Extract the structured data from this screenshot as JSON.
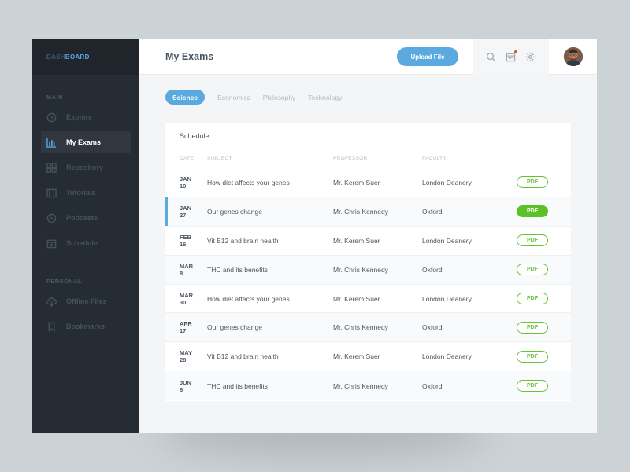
{
  "brand": {
    "part1": "DASH",
    "part2": "BOARD"
  },
  "sidebar": {
    "main_label": "MAIN",
    "main_items": [
      {
        "label": "Explore",
        "icon": "compass-icon"
      },
      {
        "label": "My Exams",
        "icon": "chart-icon",
        "active": true
      },
      {
        "label": "Repository",
        "icon": "grid-icon"
      },
      {
        "label": "Tutorials",
        "icon": "film-icon"
      },
      {
        "label": "Podcasts",
        "icon": "play-icon"
      },
      {
        "label": "Schedule",
        "icon": "calendar-icon"
      }
    ],
    "personal_label": "PERSONAL",
    "personal_items": [
      {
        "label": "Offline Files",
        "icon": "cloud-download-icon"
      },
      {
        "label": "Bookmarks",
        "icon": "bookmark-icon"
      }
    ]
  },
  "header": {
    "title": "My Exams",
    "upload_label": "Upload File"
  },
  "tabs": [
    "Science",
    "Economics",
    "Philosophy",
    "Technology"
  ],
  "schedule": {
    "title": "Schedule",
    "columns": [
      "DATE",
      "SUBJECT",
      "PROFESSOR",
      "FACULTY"
    ],
    "rows": [
      {
        "month": "JAN",
        "day": "10",
        "subject": "How diet affects your genes",
        "professor": "Mr. Kerem Suer",
        "faculty": "London Deanery",
        "pdf": "PDF"
      },
      {
        "month": "JAN",
        "day": "27",
        "subject": "Our genes change",
        "professor": "Mr. Chris Kennedy",
        "faculty": "Oxford",
        "pdf": "PDF"
      },
      {
        "month": "FEB",
        "day": "16",
        "subject": "Vit B12 and brain health",
        "professor": "Mr. Kerem Suer",
        "faculty": "London Deanery",
        "pdf": "PDF"
      },
      {
        "month": "MAR",
        "day": "8",
        "subject": "THC and its benefits",
        "professor": "Mr. Chris Kennedy",
        "faculty": "Oxford",
        "pdf": "PDF"
      },
      {
        "month": "MAR",
        "day": "30",
        "subject": "How diet affects your genes",
        "professor": "Mr. Kerem Suer",
        "faculty": "London Deanery",
        "pdf": "PDF"
      },
      {
        "month": "APR",
        "day": "17",
        "subject": "Our genes change",
        "professor": "Mr. Chris Kennedy",
        "faculty": "Oxford",
        "pdf": "PDF"
      },
      {
        "month": "MAY",
        "day": "28",
        "subject": "Vit B12 and brain health",
        "professor": "Mr. Kerem Suer",
        "faculty": "London Deanery",
        "pdf": "PDF"
      },
      {
        "month": "JUN",
        "day": "6",
        "subject": "THC and its benefits",
        "professor": "Mr. Chris Kennedy",
        "faculty": "Oxford",
        "pdf": "PDF"
      }
    ]
  },
  "colors": {
    "accent": "#5aa9df",
    "pdf_green": "#5cc127",
    "sidebar_bg": "#262c33"
  }
}
